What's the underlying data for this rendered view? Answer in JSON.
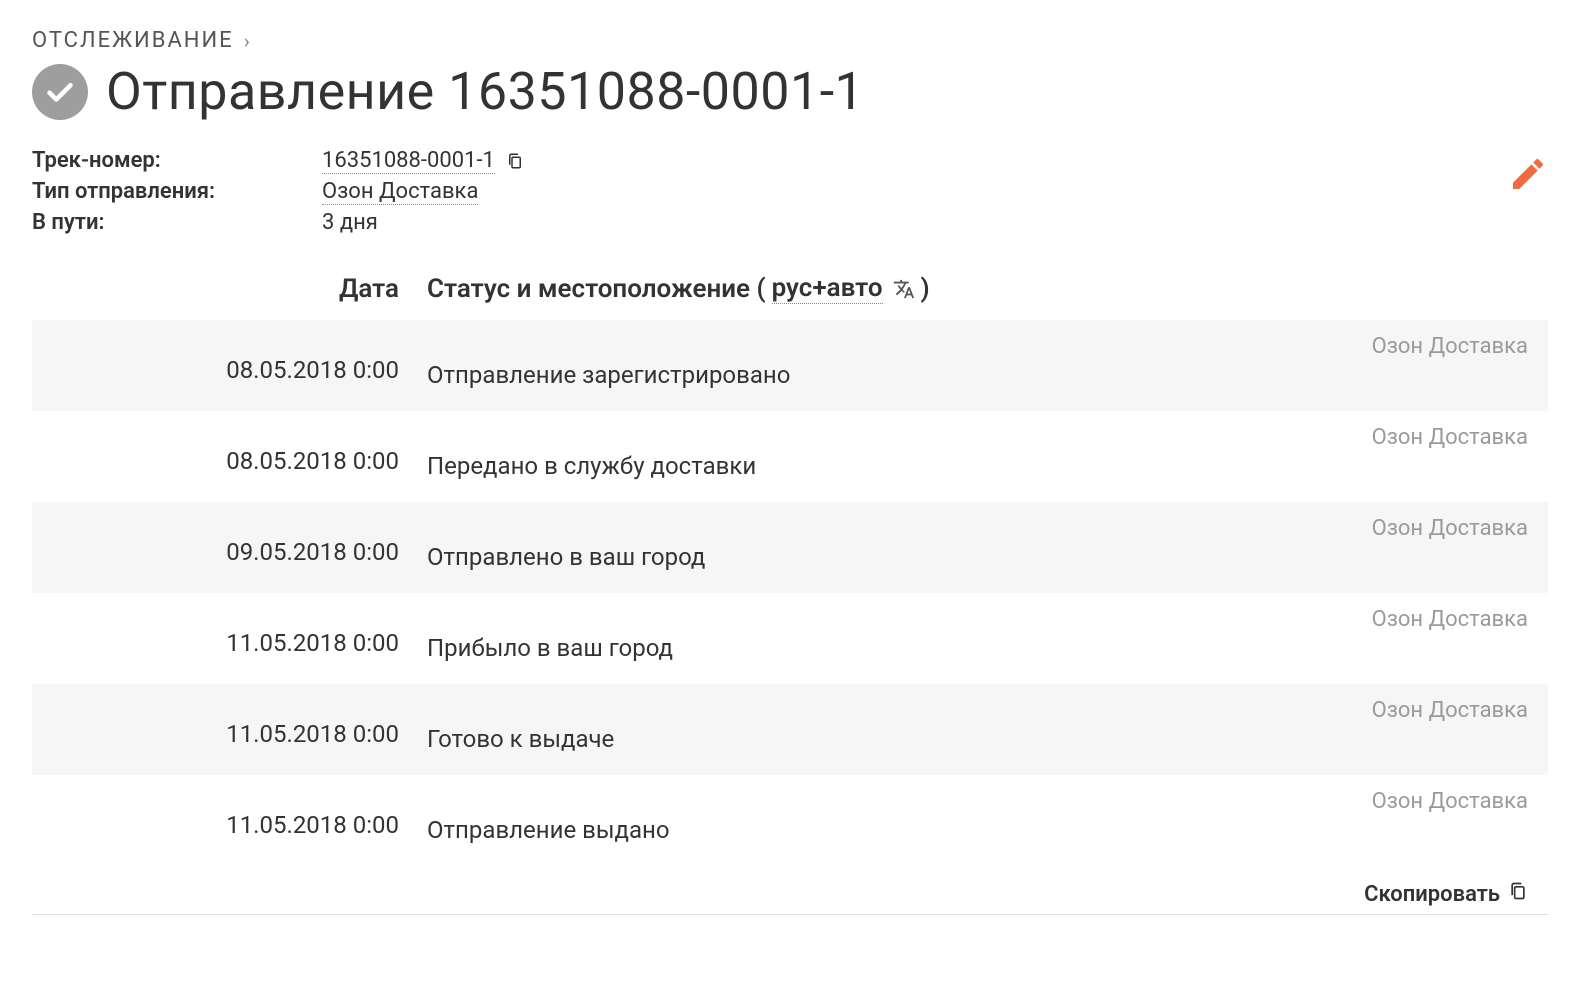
{
  "breadcrumb": {
    "label": "ОТСЛЕЖИВАНИЕ"
  },
  "title": "Отправление 16351088-0001-1",
  "meta": {
    "track_label": "Трек-номер:",
    "track_value": "16351088-0001-1",
    "type_label": "Тип отправления:",
    "type_value": "Озон Доставка",
    "transit_label": "В пути:",
    "transit_value": "3 дня"
  },
  "columns": {
    "date": "Дата",
    "status_prefix": "Статус и местоположение ( ",
    "lang": "рус+авто",
    "status_suffix": " )"
  },
  "events": [
    {
      "date": "08.05.2018 0:00",
      "status": "Отправление зарегистрировано",
      "carrier": "Озон Доставка"
    },
    {
      "date": "08.05.2018 0:00",
      "status": "Передано в службу доставки",
      "carrier": "Озон Доставка"
    },
    {
      "date": "09.05.2018 0:00",
      "status": "Отправлено в ваш город",
      "carrier": "Озон Доставка"
    },
    {
      "date": "11.05.2018 0:00",
      "status": "Прибыло в ваш город",
      "carrier": "Озон Доставка"
    },
    {
      "date": "11.05.2018 0:00",
      "status": "Готово к выдаче",
      "carrier": "Озон Доставка"
    },
    {
      "date": "11.05.2018 0:00",
      "status": "Отправление выдано",
      "carrier": "Озон Доставка"
    }
  ],
  "footer": {
    "copy_label": "Скопировать"
  }
}
